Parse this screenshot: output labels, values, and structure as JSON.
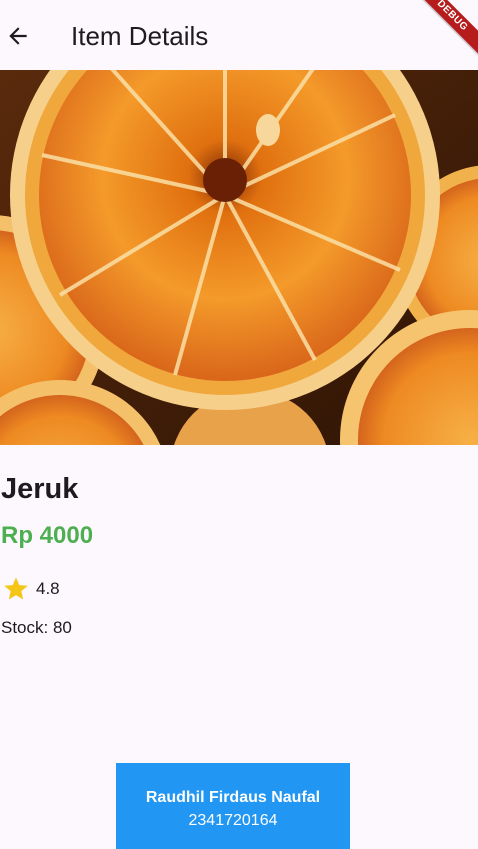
{
  "appbar": {
    "title": "Item Details",
    "back_icon": "arrow-left-icon"
  },
  "debug_banner": "DEBUG",
  "hero": {
    "image": "oranges-photo"
  },
  "item": {
    "name": "Jeruk",
    "price": "Rp 4000",
    "rating": "4.8",
    "rating_icon": "star-icon",
    "stock_label": "Stock: ",
    "stock_value": "80"
  },
  "footer": {
    "name": "Raudhil Firdaus Naufal",
    "nim": "2341720164"
  },
  "colors": {
    "background": "#fdf7fe",
    "price": "#4caf50",
    "star": "#f5c518",
    "footer_bg": "#2196f3",
    "debug_banner": "#b71c1c"
  }
}
